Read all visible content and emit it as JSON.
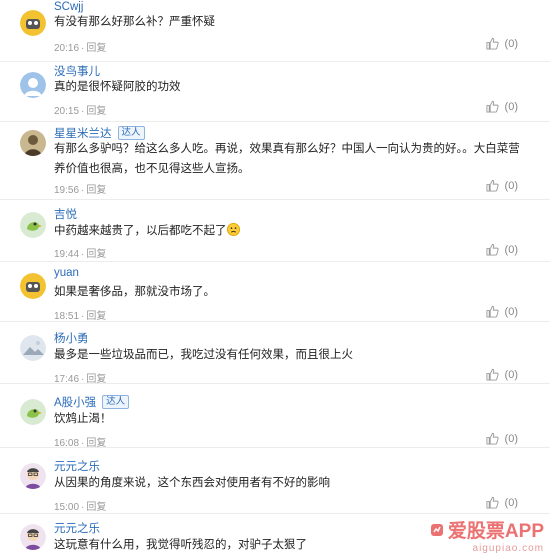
{
  "comments": [
    {
      "author": "SCwjj",
      "badge": "",
      "text": "有没有那么好那么补？严重怀疑",
      "time": "20:16",
      "reply": "回复",
      "likes": "(0)",
      "avatar": "yellow-robot-icon"
    },
    {
      "author": "没鸟事儿",
      "badge": "",
      "text": "真的是很怀疑阿胶的功效",
      "time": "20:15",
      "reply": "回复",
      "likes": "(0)",
      "avatar": "default-avatar-icon"
    },
    {
      "author": "星星米兰达",
      "badge": "达人",
      "text": "有那么多驴吗？给这么多人吃。再说，效果真有那么好？中国人一向认为贵的好。。大白菜营养价值也很高，也不见得这些人宣扬。",
      "time": "19:56",
      "reply": "回复",
      "likes": "(0)",
      "avatar": "portrait-avatar-icon"
    },
    {
      "author": "吉悦",
      "badge": "",
      "text": "中药越来越贵了，以后都吃不起了",
      "time": "19:44",
      "reply": "回复",
      "likes": "(0)",
      "avatar": "green-bird-icon"
    },
    {
      "author": "yuan",
      "badge": "",
      "text": "如果是奢侈品，那就没市场了。",
      "time": "18:51",
      "reply": "回复",
      "likes": "(0)",
      "avatar": "yellow-robot-icon"
    },
    {
      "author": "杨小勇",
      "badge": "",
      "text": "最多是一些垃圾品而已，我吃过没有任何效果，而且很上火",
      "time": "17:46",
      "reply": "回复",
      "likes": "(0)",
      "avatar": "landscape-avatar-icon"
    },
    {
      "author": "A股小强",
      "badge": "达人",
      "text": "饮鸩止渴！",
      "time": "16:08",
      "reply": "回复",
      "likes": "(0)",
      "avatar": "green-bird-icon"
    },
    {
      "author": "元元之乐",
      "badge": "",
      "text": "从因果的角度来说，这个东西会对使用者有不好的影响",
      "time": "15:00",
      "reply": "回复",
      "likes": "(0)",
      "avatar": "cartoon-man-icon"
    },
    {
      "author": "元元之乐",
      "badge": "",
      "text": "这玩意有什么用，我觉得听残忍的，对驴子太狠了",
      "time": "",
      "reply": "",
      "likes": "",
      "avatar": "cartoon-man-icon"
    }
  ],
  "watermark": {
    "title": "爱股票APP",
    "sub": "aigupiao.com"
  },
  "colors": {
    "link": "#2b6cb8",
    "meta": "#999999",
    "divider": "#ececec",
    "watermark": "#e85a5a"
  }
}
